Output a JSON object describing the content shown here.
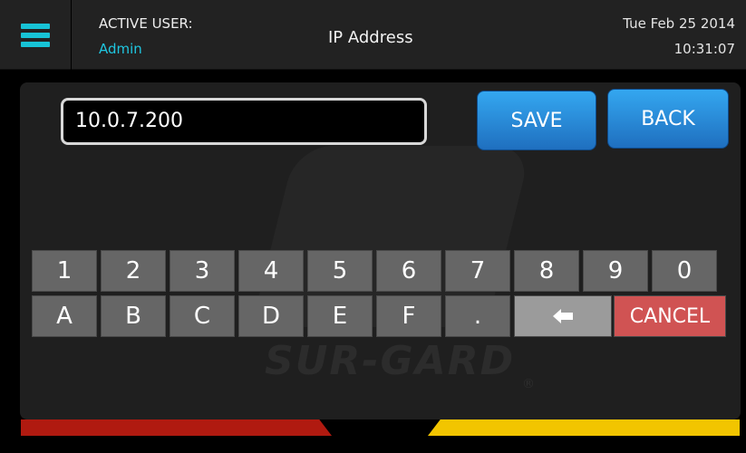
{
  "header": {
    "active_user_label": "ACTIVE USER:",
    "active_user_name": "Admin",
    "title": "IP Address",
    "date": "Tue Feb 25 2014",
    "time": "10:31:07"
  },
  "ip_field": {
    "value": "10.0.7.200"
  },
  "buttons": {
    "save": "SAVE",
    "back": "BACK"
  },
  "keypad": {
    "row1": [
      "1",
      "2",
      "3",
      "4",
      "5",
      "6",
      "7",
      "8",
      "9",
      "0"
    ],
    "row2": [
      "A",
      "B",
      "C",
      "D",
      "E",
      "F",
      "."
    ],
    "backspace_icon": "backspace-arrow-icon",
    "cancel": "CANCEL"
  },
  "watermark": {
    "brand": "SUR-GARD",
    "registered": "®"
  },
  "colors": {
    "accent_cyan": "#1fc6e0",
    "button_blue": "#2a8ee0",
    "cancel_red": "#d05353",
    "bar_red": "#b01a10",
    "bar_yellow": "#f2c500"
  }
}
